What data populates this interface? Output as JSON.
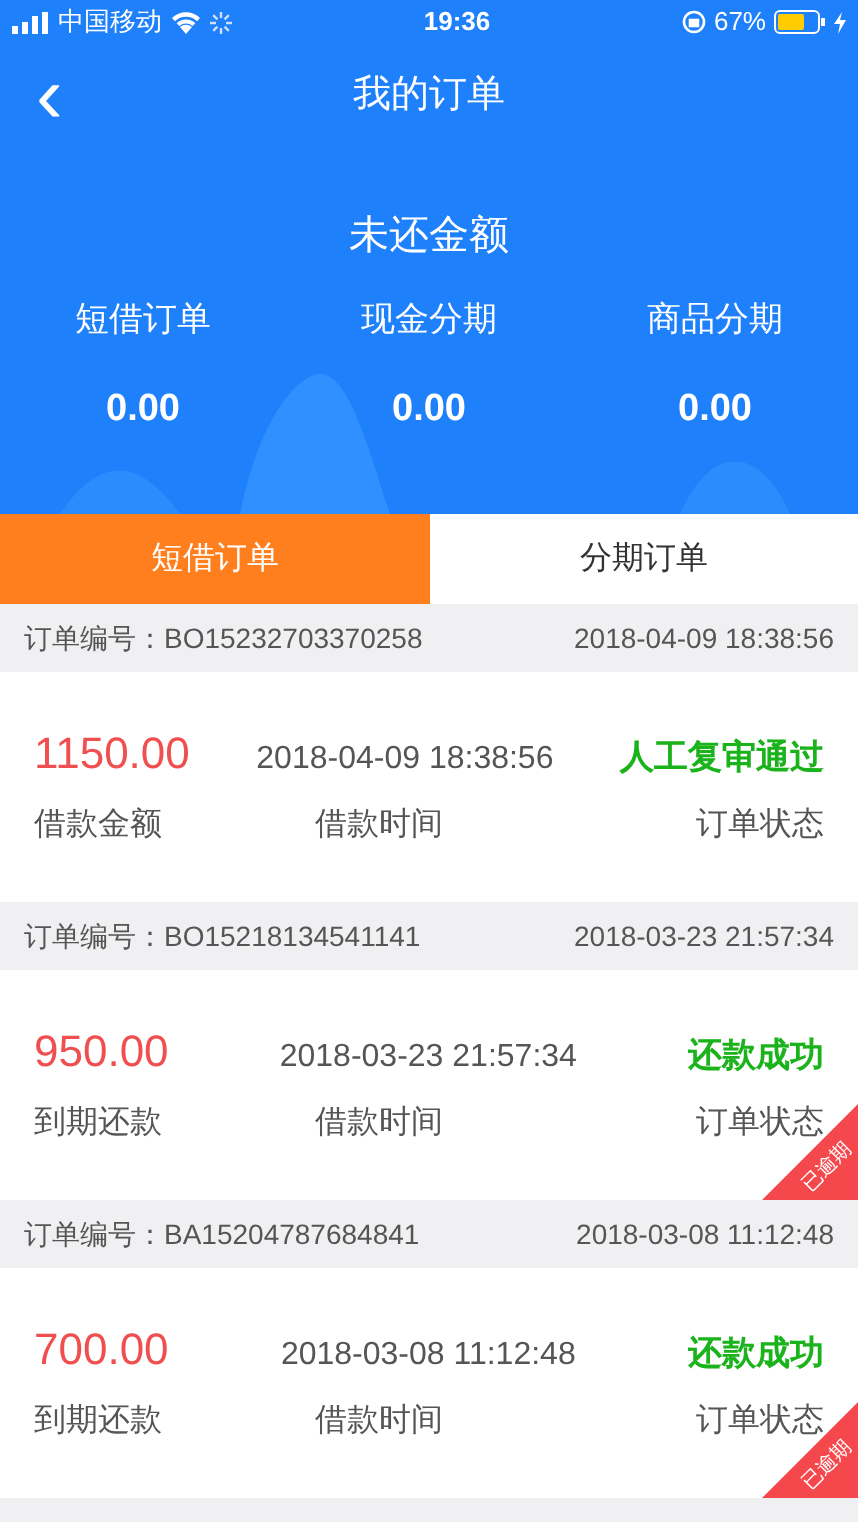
{
  "status_bar": {
    "carrier": "中国移动",
    "time": "19:36",
    "battery": "67%"
  },
  "nav": {
    "back": "‹",
    "title": "我的订单"
  },
  "summary": {
    "title": "未还金额",
    "items": [
      {
        "label": "短借订单",
        "value": "0.00"
      },
      {
        "label": "现金分期",
        "value": "0.00"
      },
      {
        "label": "商品分期",
        "value": "0.00"
      }
    ]
  },
  "tabs": [
    {
      "label": "短借订单",
      "selected": true
    },
    {
      "label": "分期订单",
      "selected": false
    }
  ],
  "orders": [
    {
      "number": "订单编号：BO15232703370258",
      "created": "2018-04-09 18:38:56",
      "amount": "1150.00",
      "amount_label": "借款金额",
      "time": "2018-04-09 18:38:56",
      "time_label": "借款时间",
      "status": "人工复审通过",
      "status_label": "订单状态"
    },
    {
      "number": "订单编号：BO15218134541141",
      "created": "2018-03-23 21:57:34",
      "amount": "950.00",
      "amount_label": "到期还款",
      "time": "2018-03-23 21:57:34",
      "time_label": "借款时间",
      "status": "还款成功",
      "status_label": "订单状态",
      "badge": "已逾期"
    },
    {
      "number": "订单编号：BA15204787684841",
      "created": "2018-03-08 11:12:48",
      "amount": "700.00",
      "amount_label": "到期还款",
      "time": "2018-03-08 11:12:48",
      "time_label": "借款时间",
      "status": "还款成功",
      "status_label": "订单状态",
      "badge": "已逾期"
    }
  ]
}
